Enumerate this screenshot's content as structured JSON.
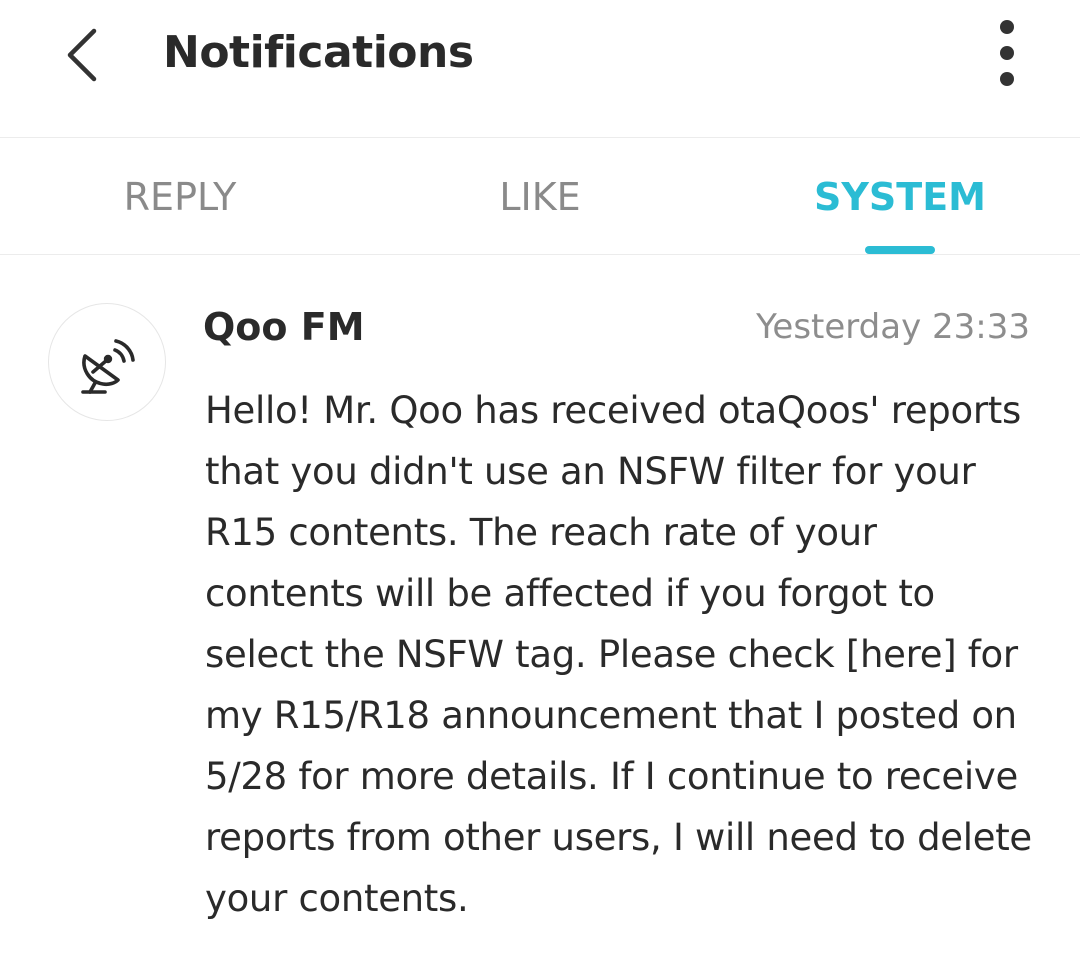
{
  "header": {
    "back_icon": "chevron-left-icon",
    "title": "Notifications",
    "more_icon": "more-vertical-icon"
  },
  "tabs": [
    {
      "label": "REPLY",
      "active": false
    },
    {
      "label": "LIKE",
      "active": false
    },
    {
      "label": "SYSTEM",
      "active": true
    }
  ],
  "accent_color": "#2bbcd4",
  "notification": {
    "avatar_icon": "satellite-dish-icon",
    "sender": "Qoo FM",
    "time": "Yesterday 23:33",
    "message": "Hello! Mr. Qoo has received otaQoos' reports that you didn't use an NSFW filter for your R15 contents. The reach rate of your contents will be affected if you forgot to select the NSFW tag. Please check [here] for my R15/R18 announcement that I posted on 5/28 for more details. If I continue to receive reports from other users, I will need to delete your contents."
  }
}
